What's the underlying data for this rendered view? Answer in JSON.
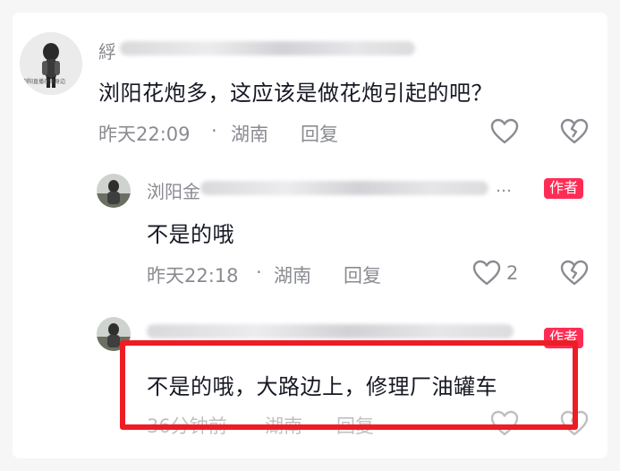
{
  "comments": [
    {
      "username_visible": "綒",
      "avatar_caption": "浏阳直播在你身边",
      "text": "浏阳花炮多，这应该是做花炮引起的吧？",
      "time": "昨天22:09",
      "sep": "·",
      "location": "湖南",
      "reply_label": "回复"
    },
    {
      "username_visible": "浏阳金",
      "ellipsis": "…",
      "badge": "作者",
      "text": "不是的哦",
      "time": "昨天22:18",
      "sep": "·",
      "location": "湖南",
      "reply_label": "回复",
      "like_count": "2"
    },
    {
      "badge": "作者",
      "text": "不是的哦，大路边上，修理厂油罐车",
      "time": "36分钟前",
      "location": "湖南",
      "reply_label": "回复"
    }
  ],
  "colors": {
    "badge": "#fe2c55",
    "highlight": "#ee1d24",
    "meta": "#8a8b91",
    "text": "#161823"
  },
  "icons": [
    "heart-icon",
    "broken-heart-icon"
  ]
}
